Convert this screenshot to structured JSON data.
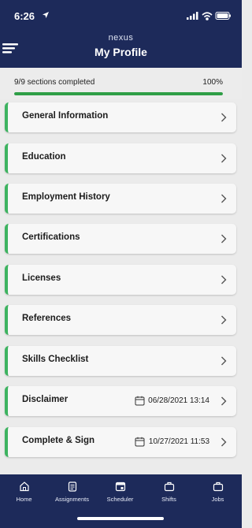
{
  "status": {
    "time": "6:26"
  },
  "header": {
    "brand": "nexus",
    "title": "My Profile"
  },
  "progress": {
    "label": "9/9 sections completed",
    "percent_text": "100%",
    "fraction": 1.0,
    "color": "#2e9e46"
  },
  "sections": [
    {
      "label": "General Information"
    },
    {
      "label": "Education"
    },
    {
      "label": "Employment History"
    },
    {
      "label": "Certifications"
    },
    {
      "label": "Licenses"
    },
    {
      "label": "References"
    },
    {
      "label": "Skills Checklist"
    },
    {
      "label": "Disclaimer",
      "date": "06/28/2021 13:14"
    },
    {
      "label": "Complete & Sign",
      "date": "10/27/2021 11:53"
    }
  ],
  "tabs": [
    {
      "label": "Home",
      "icon": "home-icon"
    },
    {
      "label": "Assignments",
      "icon": "clipboard-icon"
    },
    {
      "label": "Scheduler",
      "icon": "calendar-icon"
    },
    {
      "label": "Shifts",
      "icon": "briefcase-icon"
    },
    {
      "label": "Jobs",
      "icon": "briefcase-icon"
    }
  ],
  "colors": {
    "header_bg": "#1d2a5a",
    "accent_green": "#3db360",
    "page_bg": "#ebebeb"
  }
}
